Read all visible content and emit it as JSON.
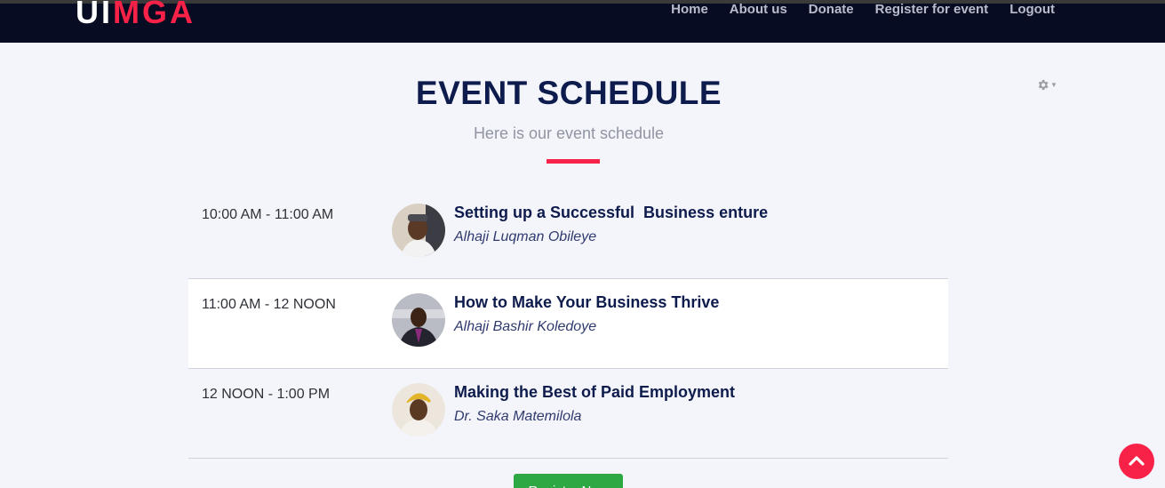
{
  "header": {
    "logo_part1": "UI",
    "logo_part2": "MGA",
    "nav": [
      "Home",
      "About us",
      "Donate",
      "Register for event",
      "Logout"
    ]
  },
  "section": {
    "title": "EVENT SCHEDULE",
    "subtitle": "Here is our event schedule"
  },
  "schedule": [
    {
      "time": "10:00 AM - 11:00 AM",
      "title": "Setting up a Successful  Business enture",
      "speaker": "Alhaji Luqman Obileye"
    },
    {
      "time": "11:00 AM - 12 NOON",
      "title": "How to Make Your Business Thrive",
      "speaker": "Alhaji Bashir Koledoye"
    },
    {
      "time": "12 NOON - 1:00 PM",
      "title": "Making the Best of Paid Employment",
      "speaker": "Dr. Saka Matemilola"
    }
  ],
  "register_button": "Register Now",
  "colors": {
    "accent": "#f82249",
    "navy": "#0e1b4d",
    "topbar": "#080c22",
    "button_green": "#2da842"
  },
  "icons": {
    "settings": "gear-icon",
    "back_to_top": "chevron-up-icon"
  }
}
